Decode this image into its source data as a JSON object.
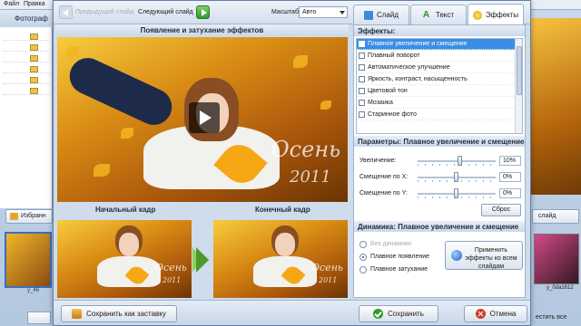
{
  "background_app": {
    "menu": [
      "Файл",
      "Правка"
    ],
    "title": "Фотограф",
    "favorites_button": "Избранн",
    "right_button": "слайд",
    "thumb_left_label": "у_46",
    "thumb_right_label": "у_0da1612",
    "bottom_right_text": "естить все"
  },
  "toolbar": {
    "prev_slide": "Предыдущий слайд",
    "next_slide": "Следующий слайд",
    "scale_label": "Масштаб:",
    "scale_value": "Авто"
  },
  "tabs": [
    {
      "label": "Слайд",
      "icon": "slide-icon",
      "active": false
    },
    {
      "label": "Текст",
      "icon": "text-icon",
      "active": false
    },
    {
      "label": "Эффекты",
      "icon": "effects-icon",
      "active": true
    }
  ],
  "preview": {
    "header": "Появление и затухание эффектов",
    "watermark_title": "Осень",
    "watermark_year": "2011"
  },
  "frames": {
    "start_label": "Начальный кадр",
    "end_label": "Конечный кадр"
  },
  "effects": {
    "title": "Эффекты:",
    "items": [
      {
        "label": "Плавное увеличение и смещение",
        "selected": true
      },
      {
        "label": "Плавный поворот",
        "selected": false
      },
      {
        "label": "Автоматическое улучшение",
        "selected": false
      },
      {
        "label": "Яркость, контраст, насыщенность",
        "selected": false
      },
      {
        "label": "Цветовой тон",
        "selected": false
      },
      {
        "label": "Мозаика",
        "selected": false
      },
      {
        "label": "Старинное фото",
        "selected": false
      }
    ]
  },
  "parameters": {
    "title": "Параметры: Плавное увеличение и смещение",
    "rows": [
      {
        "label": "Увеличение:",
        "value": "10%",
        "level": 0.55
      },
      {
        "label": "Смещение по X:",
        "value": "0%",
        "level": 0.5
      },
      {
        "label": "Смещение по Y:",
        "value": "0%",
        "level": 0.5
      }
    ],
    "reset_label": "Сброс"
  },
  "dynamics": {
    "title": "Динамика: Плавное увеличение и смещение",
    "options": [
      {
        "label": "Без динамики",
        "checked": false,
        "disabled": true
      },
      {
        "label": "Плавное появление",
        "checked": true,
        "disabled": false
      },
      {
        "label": "Плавное затухание",
        "checked": false,
        "disabled": false
      }
    ],
    "apply_button": "Применить эффекты ко всем слайдам"
  },
  "bottom": {
    "save_screensaver": "Сохранить как заставку",
    "save": "Сохранить",
    "cancel": "Отмена"
  },
  "colors": {
    "accent": "#3a8ee6",
    "save_green": "#2f9a2a",
    "cancel_red": "#d23a2a"
  }
}
